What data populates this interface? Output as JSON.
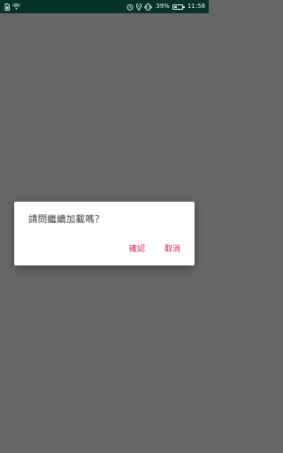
{
  "status_bar": {
    "left_icons": [
      "sim-card-icon",
      "wifi-icon"
    ],
    "right_icons": [
      "alarm-icon",
      "location-icon",
      "vibrate-icon"
    ],
    "battery_percent": "39%",
    "battery_level": 0.39,
    "time": "11:58"
  },
  "dialog": {
    "message": "請問繼續加載嗎？",
    "confirm_label": "確認",
    "cancel_label": "取消",
    "accent_color": "#d81b60"
  },
  "colors": {
    "status_bar_bg": "#05332a",
    "scrim": "#666666",
    "dialog_bg": "#ffffff"
  }
}
